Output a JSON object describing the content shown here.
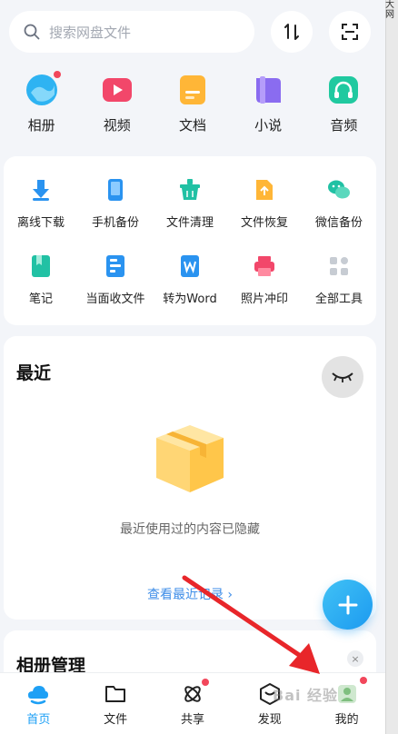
{
  "search": {
    "placeholder": "搜索网盘文件"
  },
  "header": {
    "sort_icon": "sort-icon",
    "scan_icon": "scan-icon"
  },
  "main_items": [
    {
      "label": "相册",
      "icon": "album-icon",
      "badge": true
    },
    {
      "label": "视频",
      "icon": "video-icon",
      "badge": false
    },
    {
      "label": "文档",
      "icon": "document-icon",
      "badge": false
    },
    {
      "label": "小说",
      "icon": "novel-icon",
      "badge": false
    },
    {
      "label": "音频",
      "icon": "audio-icon",
      "badge": false
    }
  ],
  "tools": [
    {
      "label": "离线下载",
      "icon": "download-icon"
    },
    {
      "label": "手机备份",
      "icon": "phone-backup-icon"
    },
    {
      "label": "文件清理",
      "icon": "file-clean-icon"
    },
    {
      "label": "文件恢复",
      "icon": "file-restore-icon"
    },
    {
      "label": "微信备份",
      "icon": "wechat-backup-icon"
    },
    {
      "label": "笔记",
      "icon": "note-icon"
    },
    {
      "label": "当面收文件",
      "icon": "receive-file-icon"
    },
    {
      "label": "转为Word",
      "icon": "to-word-icon"
    },
    {
      "label": "照片冲印",
      "icon": "photo-print-icon"
    },
    {
      "label": "全部工具",
      "icon": "all-tools-icon"
    }
  ],
  "recent": {
    "title": "最近",
    "hidden_text": "最近使用过的内容已隐藏",
    "more_link": "查看最近记录 ›"
  },
  "album_manage": {
    "title": "相册管理",
    "close": "×"
  },
  "fab": {
    "label": "+"
  },
  "tabs": [
    {
      "label": "首页",
      "icon": "home-icon",
      "active": true,
      "badge": false
    },
    {
      "label": "文件",
      "icon": "folder-icon",
      "active": false,
      "badge": false
    },
    {
      "label": "共享",
      "icon": "share-icon",
      "active": false,
      "badge": true
    },
    {
      "label": "发现",
      "icon": "discover-icon",
      "active": false,
      "badge": false
    },
    {
      "label": "我的",
      "icon": "profile-icon",
      "active": false,
      "badge": true
    }
  ],
  "edge_text": "大网",
  "watermark": "Bai 经验",
  "colors": {
    "accent": "#1ea0f5",
    "badge": "#f2475b",
    "link": "#3f8ee8",
    "arrow": "#e8262a"
  }
}
